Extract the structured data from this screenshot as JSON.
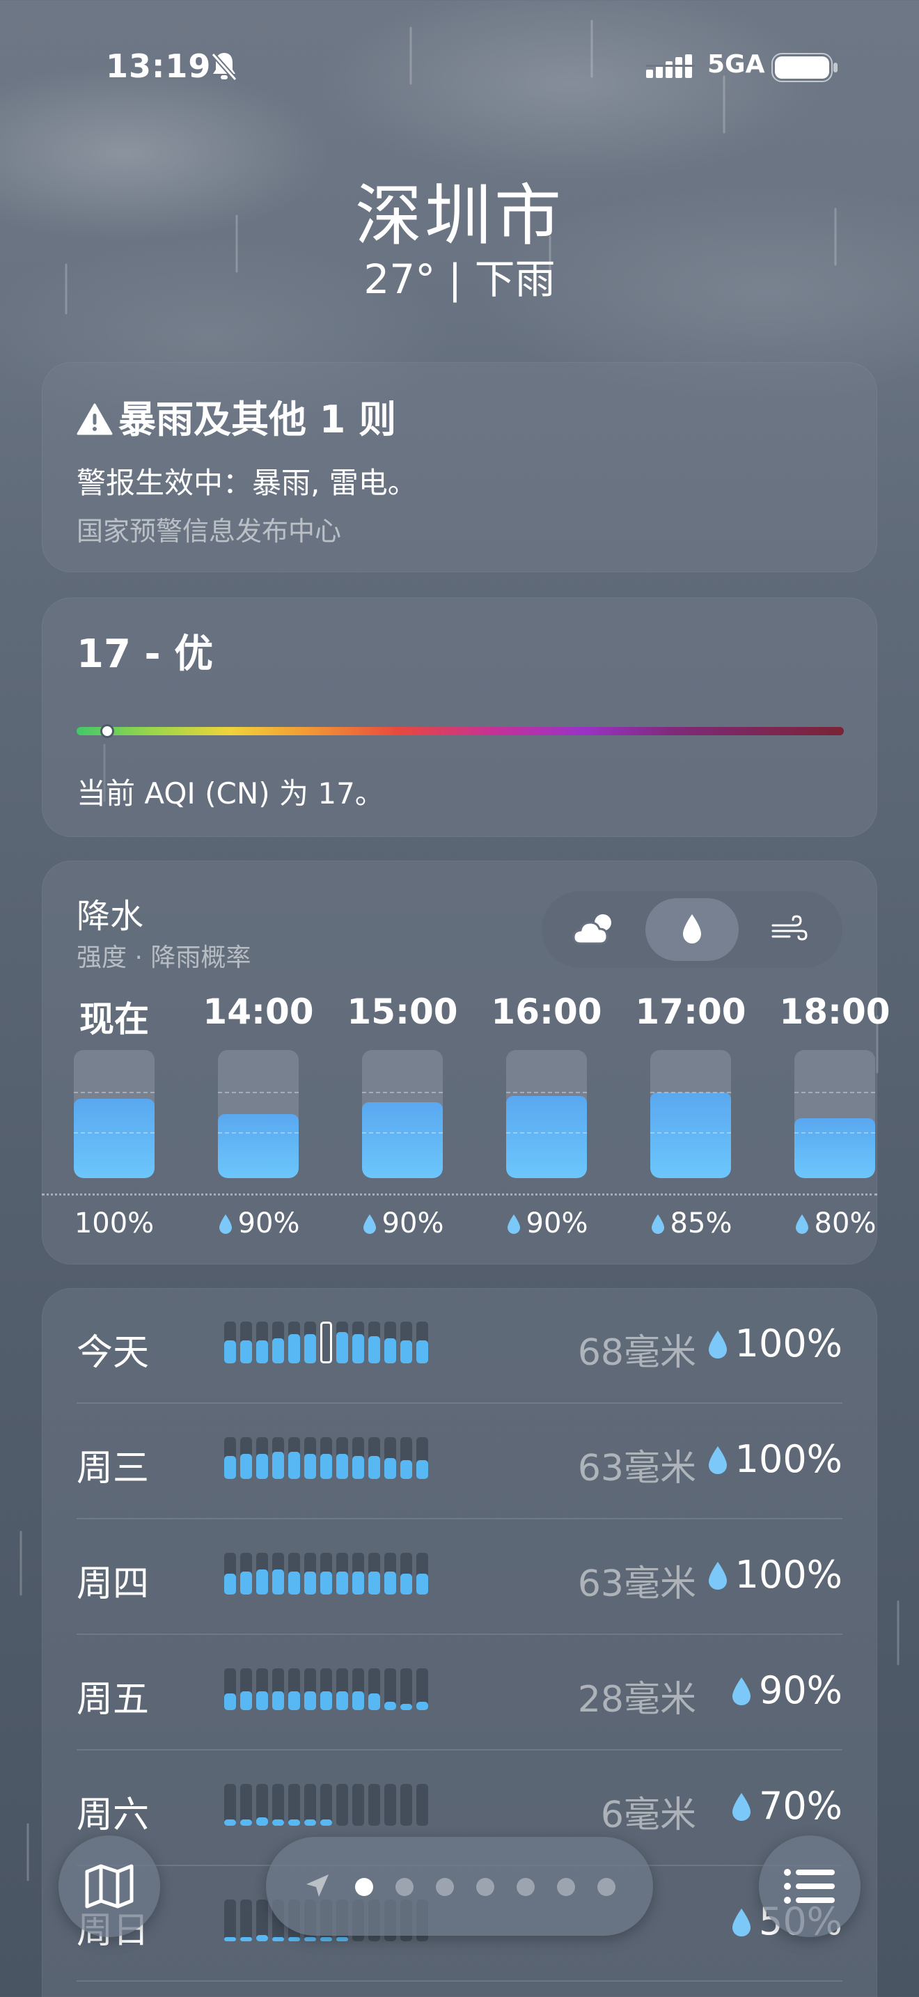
{
  "status_bar": {
    "time": "13:19",
    "network": "5GA"
  },
  "header": {
    "city": "深圳市",
    "summary": "27° | 下雨"
  },
  "alert": {
    "title": "暴雨及其他 1 则",
    "body": "警报生效中：暴雨, 雷电。",
    "source": "国家预警信息发布中心"
  },
  "aqi": {
    "value_label": "17 - 优",
    "description": "当前 AQI (CN) 为 17。",
    "position_fraction": 0.04
  },
  "precipitation": {
    "title": "降水",
    "subtitle": "强度 · 降雨概率",
    "selected_mode": "rain-drop-icon",
    "modes": [
      "cloud-sun-icon",
      "rain-drop-icon",
      "wind-icon"
    ],
    "hours": [
      {
        "label": "现在",
        "prob": "100%",
        "show_drop": false,
        "intensity": 0.62
      },
      {
        "label": "14:00",
        "prob": "90%",
        "show_drop": true,
        "intensity": 0.5
      },
      {
        "label": "15:00",
        "prob": "90%",
        "show_drop": true,
        "intensity": 0.59
      },
      {
        "label": "16:00",
        "prob": "90%",
        "show_drop": true,
        "intensity": 0.64
      },
      {
        "label": "17:00",
        "prob": "85%",
        "show_drop": true,
        "intensity": 0.67
      },
      {
        "label": "18:00",
        "prob": "80%",
        "show_drop": true,
        "intensity": 0.47
      }
    ]
  },
  "daily": [
    {
      "day": "今天",
      "amount": "68毫米",
      "prob": "100%",
      "levels": [
        0.55,
        0.55,
        0.55,
        0.6,
        0.7,
        0.7,
        0.85,
        0.75,
        0.7,
        0.65,
        0.6,
        0.55,
        0.55
      ],
      "now_index": 6
    },
    {
      "day": "周三",
      "amount": "63毫米",
      "prob": "100%",
      "levels": [
        0.55,
        0.6,
        0.6,
        0.65,
        0.65,
        0.6,
        0.6,
        0.6,
        0.55,
        0.55,
        0.5,
        0.45,
        0.45
      ]
    },
    {
      "day": "周四",
      "amount": "63毫米",
      "prob": "100%",
      "levels": [
        0.5,
        0.55,
        0.6,
        0.6,
        0.55,
        0.55,
        0.55,
        0.55,
        0.55,
        0.55,
        0.55,
        0.5,
        0.5
      ]
    },
    {
      "day": "周五",
      "amount": "28毫米",
      "prob": "90%",
      "levels": [
        0.4,
        0.45,
        0.45,
        0.45,
        0.45,
        0.45,
        0.45,
        0.45,
        0.45,
        0.4,
        0.2,
        0.15,
        0.2
      ]
    },
    {
      "day": "周六",
      "amount": "6毫米",
      "prob": "70%",
      "levels": [
        0.15,
        0.15,
        0.2,
        0.15,
        0.15,
        0.15,
        0.15,
        0,
        0,
        0,
        0,
        0,
        0
      ]
    },
    {
      "day": "周日",
      "amount": "",
      "prob": "50%",
      "levels": [
        0.1,
        0.1,
        0.15,
        0.1,
        0.1,
        0.1,
        0.1,
        0.1,
        0,
        0,
        0,
        0,
        0
      ]
    }
  ],
  "toolbar": {
    "page_count": 7,
    "active_page": 0
  }
}
